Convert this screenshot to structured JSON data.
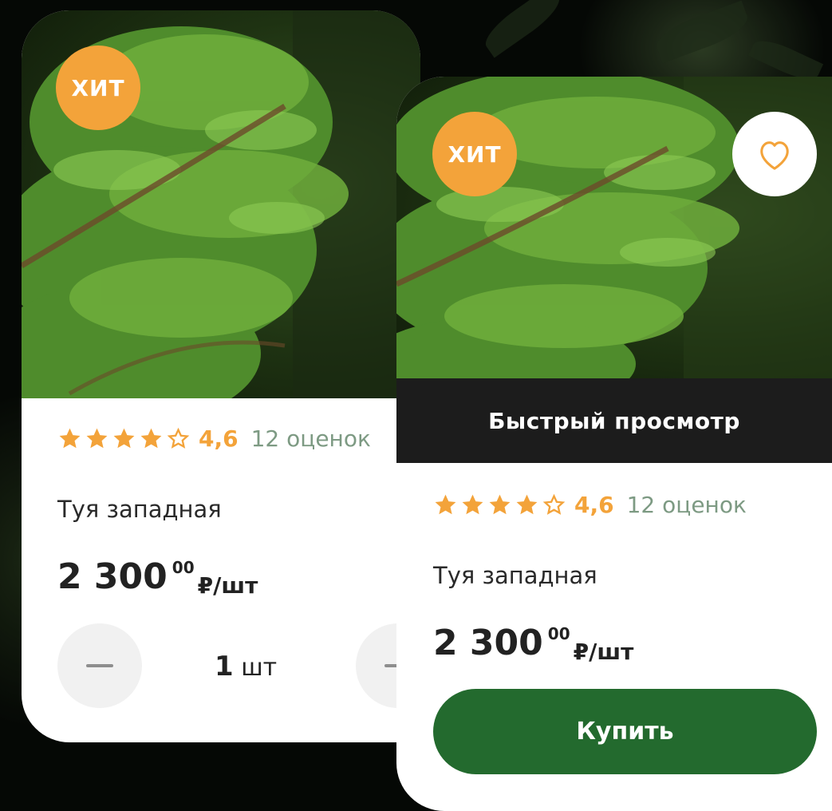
{
  "colors": {
    "accent_orange": "#f3a33a",
    "rating_count_green": "#7d9a83",
    "buy_green": "#236a2e",
    "quick_view_bg": "#1c1c1c"
  },
  "card_left": {
    "badge": "ХИТ",
    "rating": {
      "stars_filled": 4,
      "stars_total": 5,
      "value": "4,6",
      "count": "12 оценок"
    },
    "name": "Туя западная",
    "price": {
      "main": "2 300",
      "kopecks": "00",
      "unit": "₽/шт"
    },
    "quantity": {
      "value": "1",
      "unit": "шт"
    }
  },
  "card_right": {
    "badge": "ХИТ",
    "favorite_icon": "heart-outline-icon",
    "quick_view_label": "Быстрый просмотр",
    "rating": {
      "stars_filled": 4,
      "stars_total": 5,
      "value": "4,6",
      "count": "12 оценок"
    },
    "name": "Туя западная",
    "price": {
      "main": "2 300",
      "kopecks": "00",
      "unit": "₽/шт"
    },
    "buy_label": "Купить"
  }
}
